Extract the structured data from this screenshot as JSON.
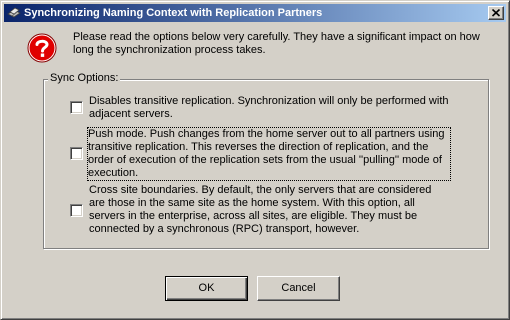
{
  "window": {
    "title": "Synchronizing Naming Context with Replication Partners",
    "icon": "replication-app-icon",
    "close_icon": "close-icon"
  },
  "intro": {
    "icon": "question-icon",
    "text": "Please read the options below very carefully.  They have a significant impact on how long the synchronization process takes."
  },
  "sync_options": {
    "label": "Sync Options:",
    "options": [
      {
        "checked": false,
        "text": "Disables transitive replication. Synchronization will only be performed with adjacent servers."
      },
      {
        "checked": false,
        "text": "Push mode. Push changes from the home server out to all partners using transitive replication.  This reverses the direction of replication, and the order of execution of the replication sets from the usual ''pulling'' mode of execution."
      },
      {
        "checked": false,
        "text": "Cross site boundaries.  By default, the only servers that are considered are those in the same site as the home system.  With this option, all servers in the enterprise, across all sites, are eligible.  They must be connected by a synchronous (RPC) transport, however."
      }
    ]
  },
  "buttons": {
    "ok": "OK",
    "cancel": "Cancel"
  },
  "colors": {
    "title_active_start": "#0a246a",
    "title_active_end": "#a6caf0",
    "face": "#d4d0c8",
    "question_red": "#e00000"
  }
}
